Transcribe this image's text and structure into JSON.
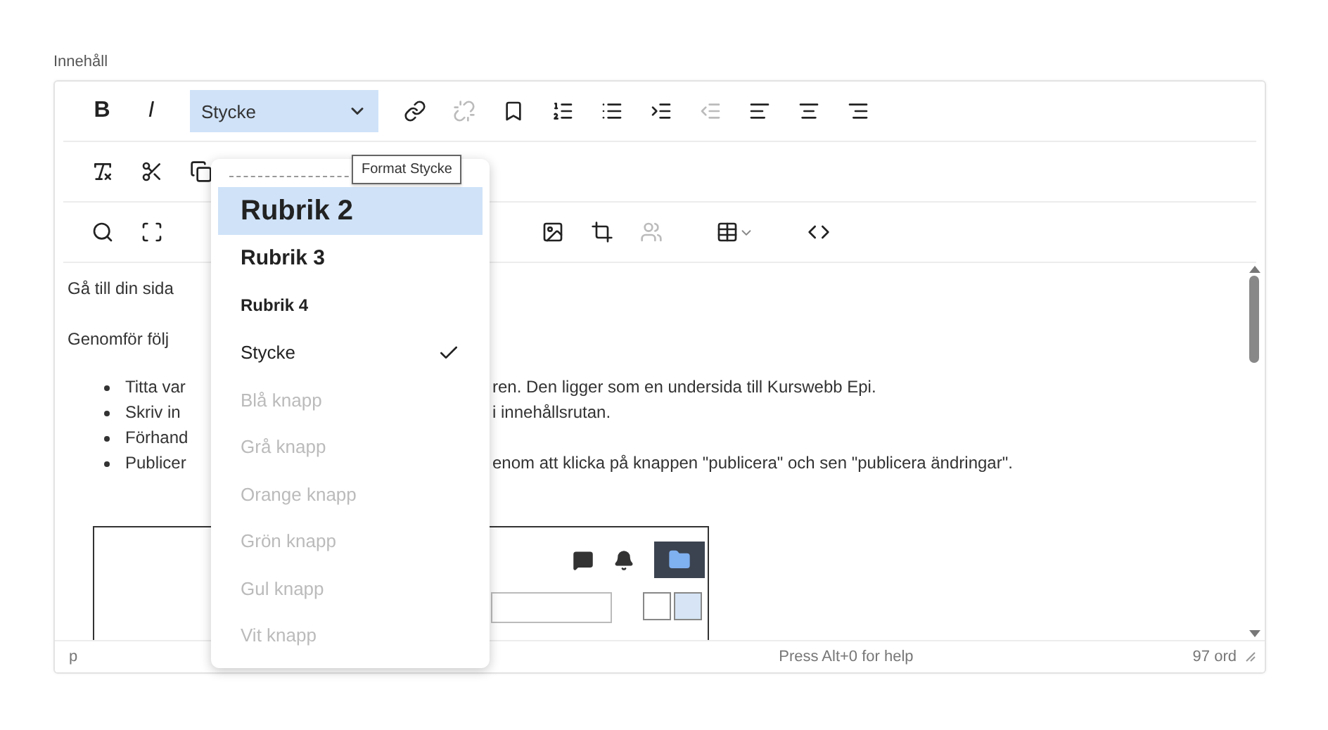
{
  "field_label": "Innehåll",
  "toolbar": {
    "rows": [
      {
        "items": [
          {
            "kind": "bold",
            "label": "B",
            "disabled": false
          },
          {
            "kind": "italic",
            "label": "I",
            "disabled": false
          },
          {
            "kind": "select",
            "value": "Stycke",
            "open": true
          },
          {
            "kind": "icon",
            "disabled": false
          },
          {
            "kind": "icon",
            "disabled": true
          },
          {
            "kind": "icon",
            "disabled": false
          },
          {
            "kind": "icon",
            "disabled": false
          },
          {
            "kind": "icon",
            "disabled": false
          },
          {
            "kind": "icon",
            "disabled": false
          },
          {
            "kind": "icon",
            "disabled": true
          },
          {
            "kind": "icon",
            "disabled": false
          },
          {
            "kind": "icon",
            "disabled": false
          },
          {
            "kind": "icon",
            "disabled": false
          }
        ]
      },
      {
        "items": [
          {
            "kind": "icon",
            "disabled": false
          },
          {
            "kind": "icon",
            "disabled": false
          },
          {
            "kind": "icon",
            "disabled": false
          }
        ]
      },
      {
        "items": [
          {
            "kind": "icon",
            "disabled": false
          },
          {
            "kind": "icon",
            "disabled": false
          },
          {
            "kind": "icon",
            "disabled": false
          },
          {
            "kind": "icon",
            "disabled": false
          },
          {
            "kind": "icon",
            "disabled": true
          },
          {
            "kind": "icon",
            "disabled": false
          },
          {
            "kind": "icon",
            "disabled": false
          }
        ]
      }
    ]
  },
  "tooltip": "Format Stycke",
  "format_menu": [
    {
      "label": "Rubrik 2",
      "kind": "h2",
      "selected": true,
      "checked": false,
      "disabled": false
    },
    {
      "label": "Rubrik 3",
      "kind": "h3",
      "selected": false,
      "checked": false,
      "disabled": false
    },
    {
      "label": "Rubrik 4",
      "kind": "h4",
      "selected": false,
      "checked": false,
      "disabled": false
    },
    {
      "label": "Stycke",
      "kind": "p",
      "selected": false,
      "checked": true,
      "disabled": false
    },
    {
      "label": "Blå knapp",
      "kind": "p",
      "selected": false,
      "checked": false,
      "disabled": true
    },
    {
      "label": "Grå knapp",
      "kind": "p",
      "selected": false,
      "checked": false,
      "disabled": true
    },
    {
      "label": "Orange knapp",
      "kind": "p",
      "selected": false,
      "checked": false,
      "disabled": true
    },
    {
      "label": "Grön knapp",
      "kind": "p",
      "selected": false,
      "checked": false,
      "disabled": true
    },
    {
      "label": "Gul knapp",
      "kind": "p",
      "selected": false,
      "checked": false,
      "disabled": true
    },
    {
      "label": "Vit knapp",
      "kind": "p",
      "selected": false,
      "checked": false,
      "disabled": true
    }
  ],
  "content": [
    {
      "kind": "paragraph",
      "left": "Gå till din sida"
    },
    {
      "kind": "paragraph",
      "left": "Genomför följ"
    },
    {
      "kind": "bullet",
      "left": "Titta var",
      "right": "ren. Den ligger som en undersida till Kurswebb Epi."
    },
    {
      "kind": "bullet",
      "left": "Skriv in",
      "right": "i innehållsrutan."
    },
    {
      "kind": "bullet",
      "left": "Förhand"
    },
    {
      "kind": "bullet",
      "left": "Publicer",
      "right": "enom att klicka på knappen \"publicera\" och sen \"publicera ändringar\"."
    },
    {
      "kind": "screenshot"
    }
  ],
  "status_bar": {
    "path": "p",
    "help": "Press Alt+0 for help",
    "word_count": "97 ord"
  }
}
